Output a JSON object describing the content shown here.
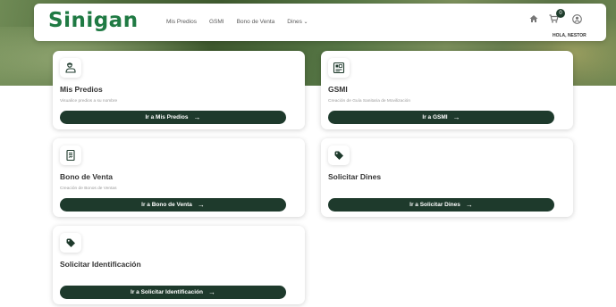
{
  "brand": {
    "logo_text": "Sinigan",
    "accent": "#1f7a43",
    "dark": "#1e3a2c"
  },
  "nav": {
    "links": [
      "Mis Predios",
      "GSMI",
      "Bono de Venta",
      "Dines"
    ],
    "cart_count": "0",
    "greeting": "HOLA, NESTOR",
    "icons": [
      "home-icon",
      "cart-icon",
      "user-icon"
    ]
  },
  "cards": [
    {
      "title": "Mis Predios",
      "description": "Visualice predios a su nombre",
      "button": "Ir a Mis Predios",
      "icon": "farmer-icon"
    },
    {
      "title": "GSMI",
      "description": "Creación de Guía Sanitaria de Movilización",
      "button": "Ir a GSMI",
      "icon": "document-grid-icon"
    },
    {
      "title": "Bono de Venta",
      "description": "Creación de Bonos de Ventas",
      "button": "Ir a Bono de Venta",
      "icon": "receipt-icon"
    },
    {
      "title": "Solicitar Dines",
      "description": "",
      "button": "Ir a Solicitar Dines",
      "icon": "tag-icon"
    },
    {
      "title": "Solicitar Identificación",
      "description": "",
      "button": "Ir a Solicitar Identificación",
      "icon": "tag-icon"
    }
  ]
}
